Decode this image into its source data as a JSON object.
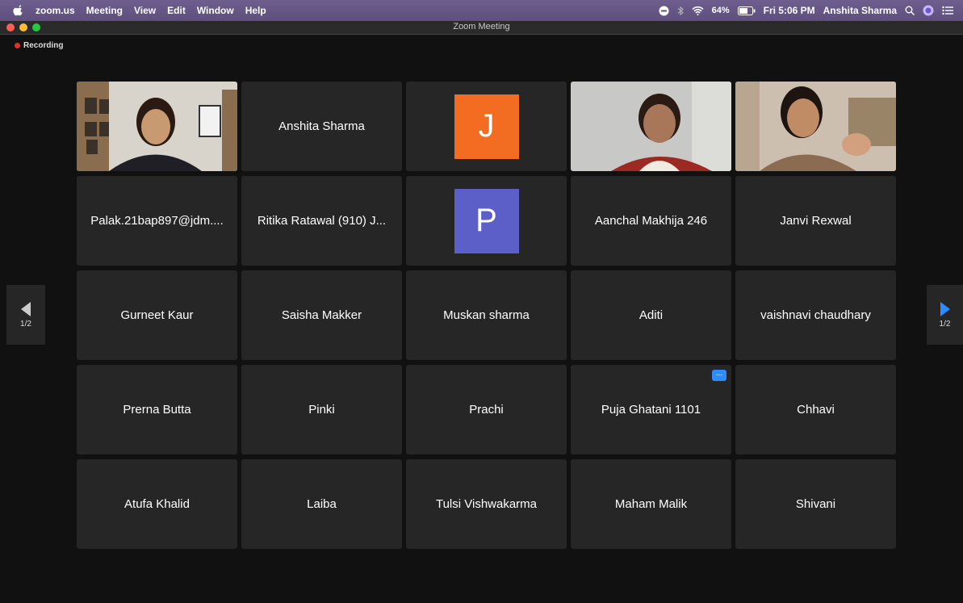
{
  "menubar": {
    "app": "zoom.us",
    "items": [
      "Meeting",
      "View",
      "Edit",
      "Window",
      "Help"
    ],
    "battery": "64%",
    "clock": "Fri 5:06 PM",
    "user": "Anshita Sharma"
  },
  "window": {
    "title": "Zoom Meeting"
  },
  "recording": {
    "label": "Recording",
    "color": "#e0302e"
  },
  "pager": {
    "left_label": "1/2",
    "right_label": "1/2",
    "right_arrow_color": "#2d8cff"
  },
  "participants": [
    {
      "name": "",
      "type": "video",
      "video": "woman-office"
    },
    {
      "name": "Anshita Sharma",
      "type": "name"
    },
    {
      "name": "",
      "type": "avatar",
      "initial": "J",
      "color": "#f26d21"
    },
    {
      "name": "",
      "type": "video",
      "video": "older-woman"
    },
    {
      "name": "",
      "type": "video",
      "video": "woman-speaking",
      "active_speaker": true
    },
    {
      "name": "Palak.21bap897@jdm....",
      "type": "name"
    },
    {
      "name": "Ritika Ratawal (910) J...",
      "type": "name"
    },
    {
      "name": "",
      "type": "avatar",
      "initial": "P",
      "color": "#5b5fc7"
    },
    {
      "name": "Aanchal Makhija 246",
      "type": "name"
    },
    {
      "name": "Janvi Rexwal",
      "type": "name"
    },
    {
      "name": "Gurneet Kaur",
      "type": "name"
    },
    {
      "name": "Saisha Makker",
      "type": "name"
    },
    {
      "name": "Muskan sharma",
      "type": "name"
    },
    {
      "name": "Aditi",
      "type": "name"
    },
    {
      "name": "vaishnavi chaudhary",
      "type": "name"
    },
    {
      "name": "Prerna Butta",
      "type": "name"
    },
    {
      "name": "Pinki",
      "type": "name"
    },
    {
      "name": "Prachi",
      "type": "name"
    },
    {
      "name": "Puja Ghatani 1101",
      "type": "name",
      "more_button": "..."
    },
    {
      "name": "Chhavi",
      "type": "name"
    },
    {
      "name": "Atufa Khalid",
      "type": "name"
    },
    {
      "name": "Laiba",
      "type": "name"
    },
    {
      "name": "Tulsi Vishwakarma",
      "type": "name"
    },
    {
      "name": "Maham Malik",
      "type": "name"
    },
    {
      "name": "Shivani",
      "type": "name"
    }
  ]
}
